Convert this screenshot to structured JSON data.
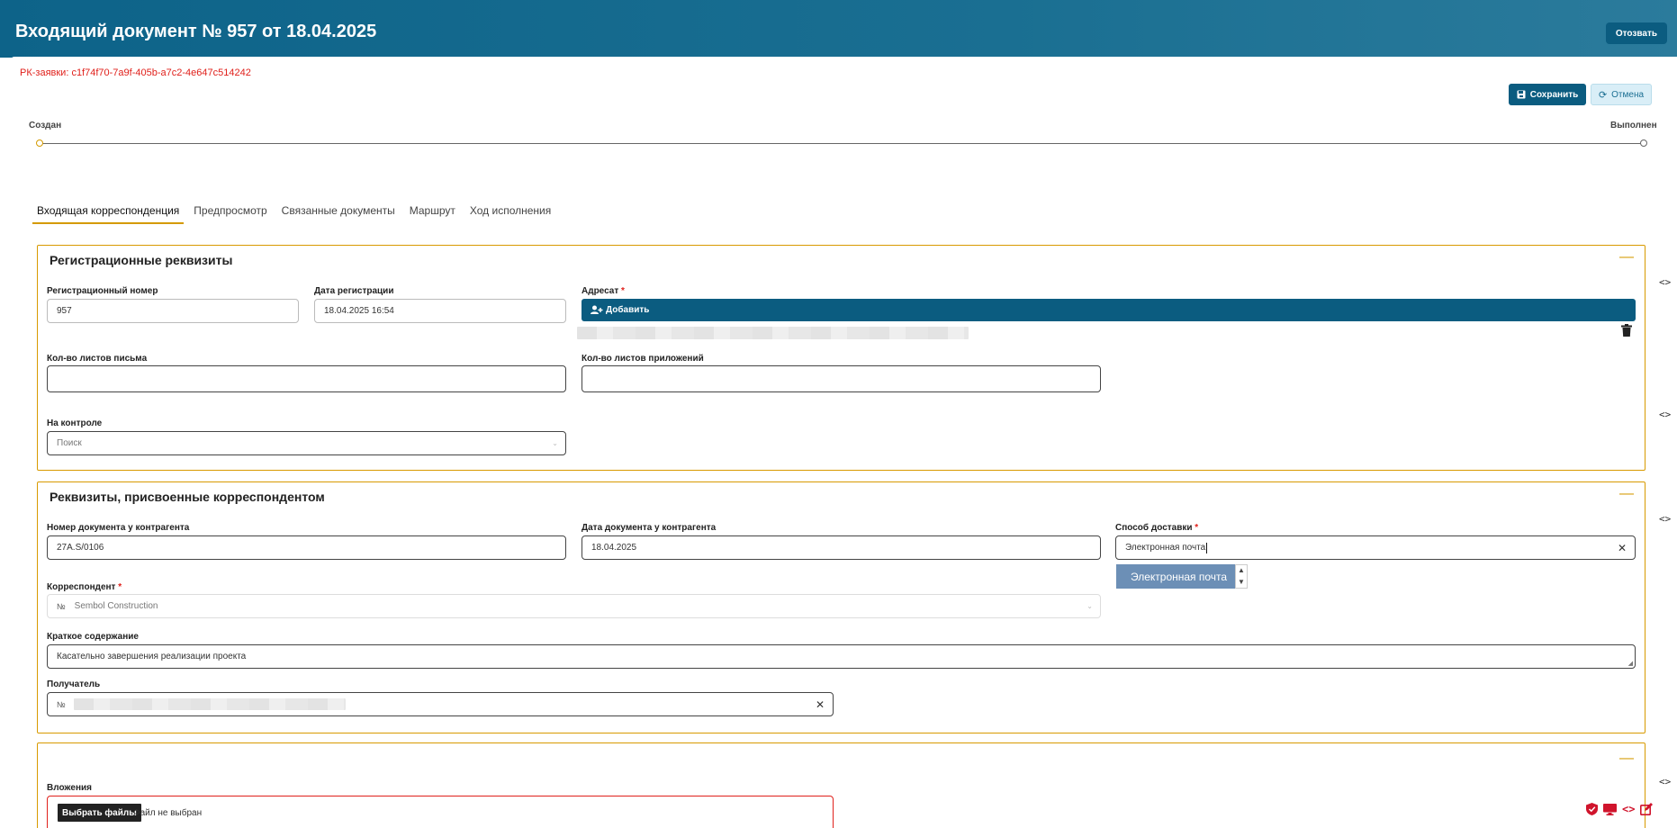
{
  "header": {
    "title": "Входящий документ № 957 от 18.04.2025",
    "revoke_label": "Отозвать"
  },
  "rk_id": "РК-заявки: c1f74f70-7a9f-405b-a7c2-4e647c514242",
  "toolbar": {
    "save_label": "Сохранить",
    "cancel_label": "Отмена"
  },
  "progress": {
    "start_label": "Создан",
    "end_label": "Выполнен",
    "value": 0
  },
  "tabs": [
    {
      "label": "Входящая корреспонденция",
      "active": true
    },
    {
      "label": "Предпросмотр"
    },
    {
      "label": "Связанные документы"
    },
    {
      "label": "Маршрут"
    },
    {
      "label": "Ход исполнения"
    }
  ],
  "reg_section": {
    "title": "Регистрационные реквизиты",
    "reg_number_label": "Регистрационный номер",
    "reg_number_value": "957",
    "reg_date_label": "Дата регистрации",
    "reg_date_value": "18.04.2025 16:54",
    "addressee_label": "Адресат",
    "add_label": "Добавить",
    "letter_sheets_label": "Кол-во листов письма",
    "letter_sheets_value": "",
    "attach_sheets_label": "Кол-во листов приложений",
    "attach_sheets_value": "",
    "control_label": "На контроле",
    "control_placeholder": "Поиск"
  },
  "corr_section": {
    "title": "Реквизиты, присвоенные корреспондентом",
    "doc_number_label": "Номер документа у контрагента",
    "doc_number_value": "27A.S/0106",
    "doc_date_label": "Дата документа у контрагента",
    "doc_date_value": "18.04.2025",
    "delivery_label": "Способ доставки",
    "delivery_value": "Электронная почта",
    "delivery_option": "Электронная почта",
    "correspondent_label": "Корреспондент",
    "correspondent_no": "№",
    "correspondent_value": "Sembol Construction",
    "summary_label": "Краткое содержание",
    "summary_value": "Касательно завершения реализации проекта",
    "recipient_label": "Получатель",
    "recipient_no": "№"
  },
  "attach_section": {
    "label": "Вложения",
    "choose_label": "Выбрать файлы",
    "no_file_label": "Файл не выбран"
  },
  "colors": {
    "primary": "#0b5c80",
    "accent": "#d49a00",
    "required": "#e0201b",
    "dropdown_highlight": "#6c8fb6"
  }
}
